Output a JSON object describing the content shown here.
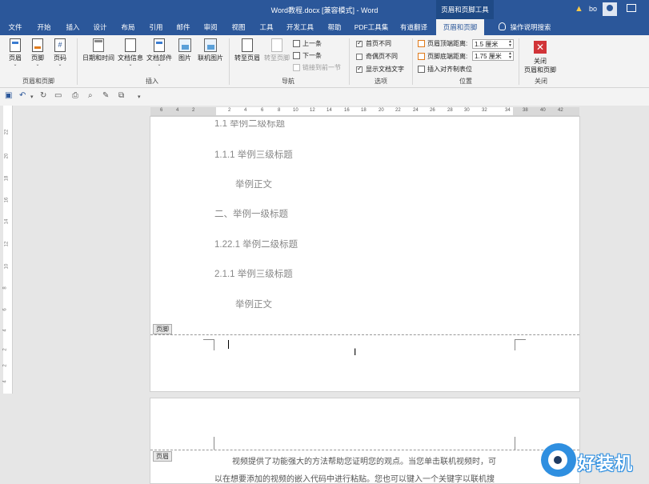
{
  "titlebar": {
    "title": "Word教程.docx [兼容模式]  -  Word",
    "context_tab": "页眉和页脚工具",
    "user": "bo"
  },
  "tabs": [
    {
      "label": "文件"
    },
    {
      "label": "开始"
    },
    {
      "label": "插入"
    },
    {
      "label": "设计"
    },
    {
      "label": "布局"
    },
    {
      "label": "引用"
    },
    {
      "label": "邮件"
    },
    {
      "label": "审阅"
    },
    {
      "label": "视图"
    },
    {
      "label": "工具"
    },
    {
      "label": "开发工具"
    },
    {
      "label": "帮助"
    },
    {
      "label": "PDF工具集"
    },
    {
      "label": "有道翻译"
    },
    {
      "label": "页眉和页脚"
    },
    {
      "label": "操作说明搜索"
    }
  ],
  "ribbon": {
    "hf_group": {
      "label": "页眉和页脚",
      "header": "页眉",
      "footer": "页脚",
      "page_number": "页码"
    },
    "insert_group": {
      "label": "插入",
      "datetime": "日期和时间",
      "docinfo": "文档信息",
      "quickparts": "文档部件",
      "picture": "图片",
      "online_picture": "联机图片"
    },
    "nav_group": {
      "label": "导航",
      "goto_header": "转至页眉",
      "goto_footer": "转至页脚",
      "previous": "上一条",
      "next": "下一条",
      "link_previous": "链接到前一节"
    },
    "options_group": {
      "label": "选项",
      "diff_first": "首页不同",
      "diff_odd_even": "奇偶页不同",
      "show_doc_text": "显示文档文字"
    },
    "position_group": {
      "label": "位置",
      "header_from_top": "页眉顶端距离:",
      "header_value": "1.5 厘米",
      "footer_from_bottom": "页脚底端距离:",
      "footer_value": "1.75 厘米",
      "insert_align_tab": "插入对齐制表位"
    },
    "close_group": {
      "label": "关闭",
      "close_line1": "关闭",
      "close_line2": "页眉和页脚"
    }
  },
  "ruler": {
    "horizontal": [
      "6",
      "4",
      "2",
      "2",
      "4",
      "6",
      "8",
      "10",
      "12",
      "14",
      "16",
      "18",
      "20",
      "22",
      "24",
      "26",
      "28",
      "30",
      "32",
      "34",
      "38",
      "40",
      "42"
    ],
    "vertical": [
      "22",
      "20",
      "18",
      "16",
      "14",
      "12",
      "10",
      "8",
      "6",
      "4",
      "2",
      "2",
      "4"
    ]
  },
  "document": {
    "page1_lines": [
      "1.1 举例二级标题",
      "1.1.1 举例三级标题",
      "举例正文",
      "二、举例一级标题",
      "1.22.1 举例二级标题",
      "2.1.1 举例三级标题",
      "举例正文"
    ],
    "footer_tag": "页脚",
    "header_tag": "页眉",
    "page2_line1": "视频提供了功能强大的方法帮助您证明您的观点。当您单击联机视频时，可",
    "page2_line2": "以在想要添加的视频的嵌入代码中进行粘贴。您也可以键入一个关键字以联机搜"
  },
  "watermark": {
    "text": "好装机"
  }
}
